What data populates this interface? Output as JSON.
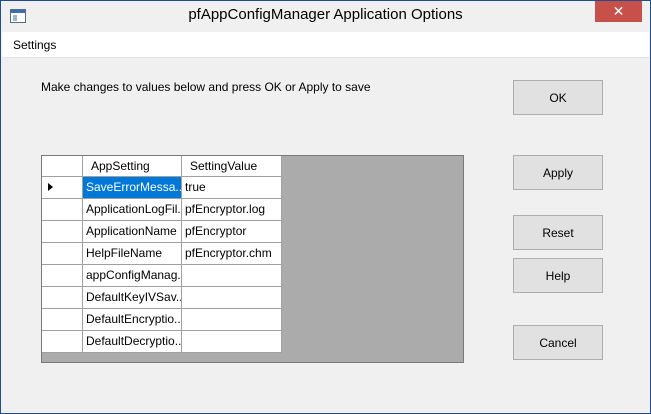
{
  "window": {
    "title": "pfAppConfigManager Application Options",
    "close_glyph": "✕"
  },
  "menu": {
    "items": [
      {
        "label": "Settings"
      }
    ]
  },
  "instructions": "Make changes to values below and press OK or Apply to save",
  "grid": {
    "columns": [
      "AppSetting",
      "SettingValue"
    ],
    "rows": [
      {
        "setting": "SaveErrorMessa...",
        "value": "true",
        "selected": true,
        "current": true
      },
      {
        "setting": "ApplicationLogFil...",
        "value": "pfEncryptor.log"
      },
      {
        "setting": "ApplicationName",
        "value": "pfEncryptor"
      },
      {
        "setting": "HelpFileName",
        "value": "pfEncryptor.chm"
      },
      {
        "setting": "appConfigManag...",
        "value": ""
      },
      {
        "setting": "DefaultKeyIVSav...",
        "value": ""
      },
      {
        "setting": "DefaultEncryptio...",
        "value": ""
      },
      {
        "setting": "DefaultDecryptio...",
        "value": ""
      }
    ]
  },
  "buttons": {
    "ok": "OK",
    "apply": "Apply",
    "reset": "Reset",
    "help": "Help",
    "cancel": "Cancel"
  },
  "colors": {
    "selection": "#0078d7",
    "close": "#c7504b",
    "grid_background": "#ababab"
  }
}
